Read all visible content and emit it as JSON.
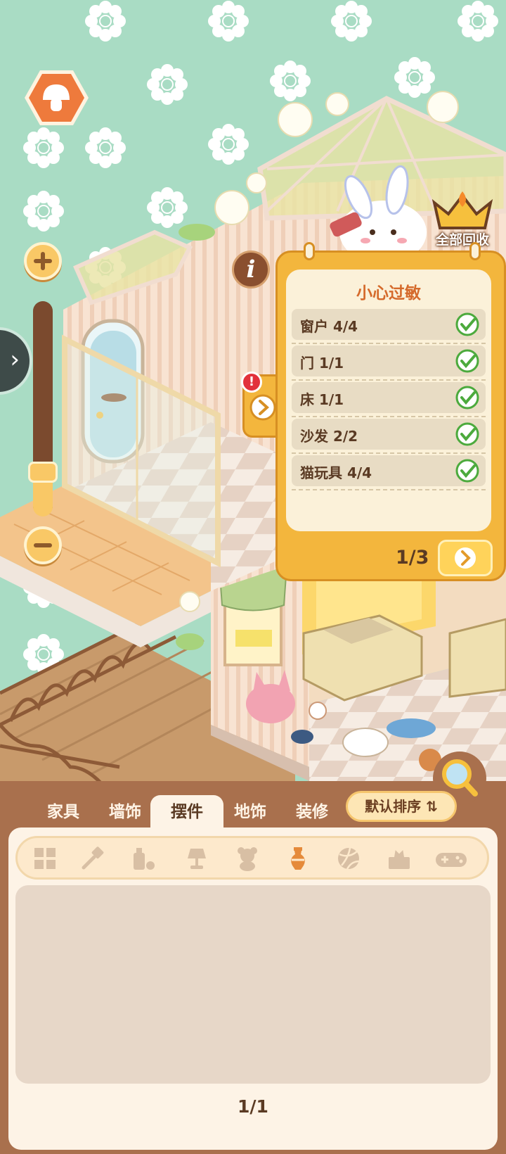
{
  "task_panel": {
    "title": "小心过敏",
    "items": [
      {
        "label": "窗户 4/4",
        "done": true
      },
      {
        "label": "门 1/1",
        "done": true
      },
      {
        "label": "床 1/1",
        "done": true
      },
      {
        "label": "沙发 2/2",
        "done": true
      },
      {
        "label": "猫玩具 4/4",
        "done": true
      }
    ],
    "page": "1/3"
  },
  "hud": {
    "collect_all_label": "全部回收",
    "alert_mark": "!",
    "info_mark": "i",
    "expand_arrow": "›",
    "zoom_level": 0.15
  },
  "inventory": {
    "tabs": [
      {
        "label": "家具",
        "active": false
      },
      {
        "label": "墙饰",
        "active": false
      },
      {
        "label": "摆件",
        "active": true
      },
      {
        "label": "地饰",
        "active": false
      },
      {
        "label": "装修",
        "active": false
      }
    ],
    "sort_label": "默认排序 ⇅",
    "categories": [
      {
        "icon": "grid-icon",
        "active": false
      },
      {
        "icon": "spatula-icon",
        "active": false
      },
      {
        "icon": "bottles-icon",
        "active": false
      },
      {
        "icon": "lamp-icon",
        "active": false
      },
      {
        "icon": "teddy-bear-icon",
        "active": false
      },
      {
        "icon": "vase-icon",
        "active": true
      },
      {
        "icon": "ball-icon",
        "active": false
      },
      {
        "icon": "tissue-box-icon",
        "active": false
      },
      {
        "icon": "gamepad-icon",
        "active": false
      }
    ],
    "page": "1/1"
  },
  "colors": {
    "background": "#a9dcc4",
    "panel_orange": "#f3b63d",
    "check_green": "#4caa3d",
    "inventory_brown": "#a9704d",
    "active_category": "#e58a3a"
  }
}
